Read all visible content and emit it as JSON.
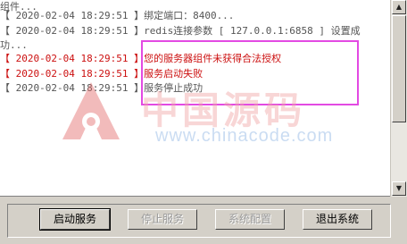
{
  "log": {
    "lines": [
      "组件...",
      "【 2020-02-04 18:29:51 】绑定端口：8400...",
      "【 2020-02-04 18:29:51 】redis连接参数 [ 127.0.0.1:6858 ] 设置成",
      "功...",
      "【 2020-02-04 18:29:51 】您的服务器组件未获得合法授权",
      "【 2020-02-04 18:29:51 】服务启动失败",
      "【 2020-02-04 18:29:51 】服务停止成功"
    ]
  },
  "watermark": {
    "text": "中国源码",
    "url": "www.chinacode.com"
  },
  "buttons": {
    "start": "启动服务",
    "stop": "停止服务",
    "config": "系统配置",
    "exit": "退出系统"
  },
  "colors": {
    "error_text": "#cc1010",
    "highlight_border": "#e34ae3"
  }
}
